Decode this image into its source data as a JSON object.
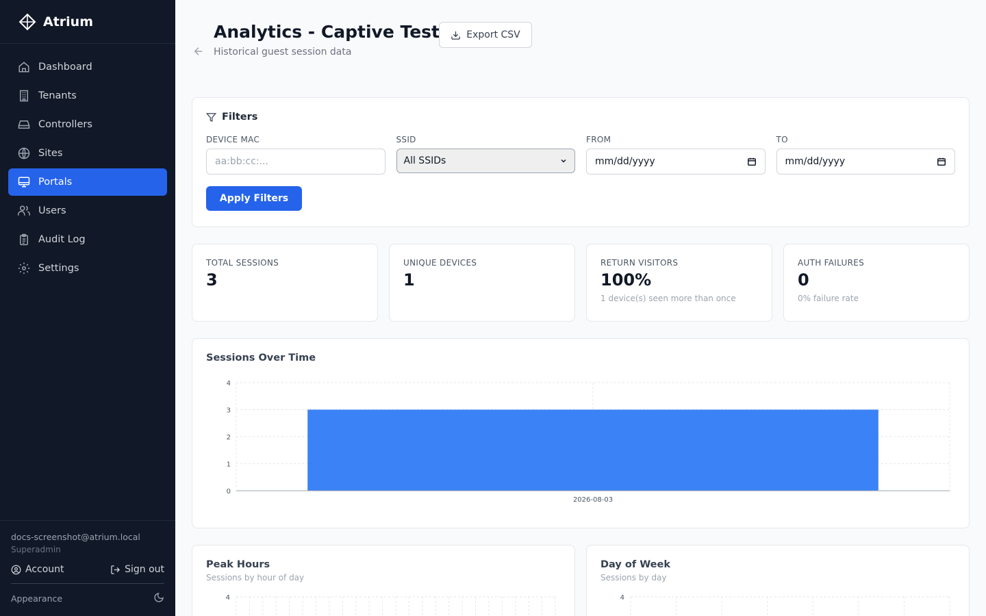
{
  "app": {
    "name": "Atrium"
  },
  "sidebar": {
    "items": [
      {
        "label": "Dashboard",
        "icon": "home-icon",
        "active": false
      },
      {
        "label": "Tenants",
        "icon": "building-icon",
        "active": false
      },
      {
        "label": "Controllers",
        "icon": "hard-drive-icon",
        "active": false
      },
      {
        "label": "Sites",
        "icon": "globe-icon",
        "active": false
      },
      {
        "label": "Portals",
        "icon": "monitor-icon",
        "active": true
      },
      {
        "label": "Users",
        "icon": "users-icon",
        "active": false
      },
      {
        "label": "Audit Log",
        "icon": "clipboard-icon",
        "active": false
      },
      {
        "label": "Settings",
        "icon": "gear-icon",
        "active": false
      }
    ],
    "user_email": "docs-screenshot@atrium.local",
    "user_role": "Superadmin",
    "account_label": "Account",
    "signout_label": "Sign out",
    "appearance_label": "Appearance"
  },
  "header": {
    "title": "Analytics - Captive Test",
    "subtitle": "Historical guest session data",
    "export_label": "Export CSV"
  },
  "filters": {
    "title": "Filters",
    "device_mac_label": "DEVICE MAC",
    "device_mac_placeholder": "aa:bb:cc:...",
    "ssid_label": "SSID",
    "ssid_value": "All SSIDs",
    "from_label": "FROM",
    "from_value": "mm/dd/yyyy",
    "to_label": "TO",
    "to_value": "mm/dd/yyyy",
    "apply_label": "Apply Filters"
  },
  "stats": [
    {
      "label": "TOTAL SESSIONS",
      "value": "3",
      "note": ""
    },
    {
      "label": "UNIQUE DEVICES",
      "value": "1",
      "note": ""
    },
    {
      "label": "RETURN VISITORS",
      "value": "100%",
      "note": "1 device(s) seen more than once"
    },
    {
      "label": "AUTH FAILURES",
      "value": "0",
      "note": "0% failure rate"
    }
  ],
  "sessions_chart": {
    "title": "Sessions Over Time"
  },
  "peak_hours": {
    "title": "Peak Hours",
    "subtitle": "Sessions by hour of day",
    "top_tick": "4"
  },
  "day_of_week": {
    "title": "Day of Week",
    "subtitle": "Sessions by day",
    "top_tick": "4"
  },
  "colors": {
    "accent": "#2563eb",
    "bar": "#3b82f6",
    "sidebar_bg": "#111827"
  },
  "chart_data": {
    "type": "bar",
    "title": "Sessions Over Time",
    "categories": [
      "2026-08-03"
    ],
    "values": [
      3
    ],
    "ylim": [
      0,
      4
    ],
    "yticks": [
      "0",
      "1",
      "2",
      "3",
      "4"
    ],
    "grid": true,
    "xlabel": "",
    "ylabel": ""
  }
}
